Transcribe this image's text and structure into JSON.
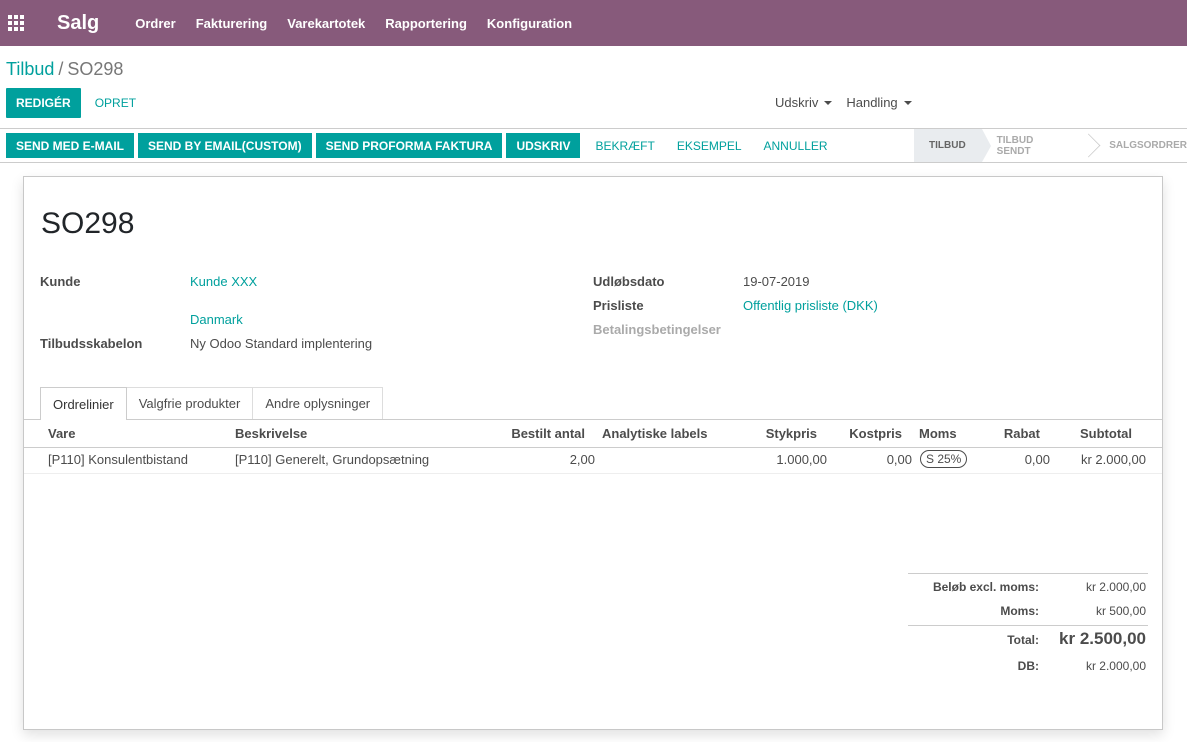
{
  "navbar": {
    "brand": "Salg",
    "menu": [
      "Ordrer",
      "Fakturering",
      "Varekartotek",
      "Rapportering",
      "Konfiguration"
    ],
    "background": "#875a7b"
  },
  "breadcrumb": {
    "parent": "Tilbud",
    "separator": "/",
    "current": "SO298"
  },
  "control": {
    "edit_label": "REDIGÉR",
    "create_label": "OPRET",
    "print_label": "Udskriv",
    "action_label": "Handling"
  },
  "statusbar": {
    "buttons": [
      "SEND MED E-MAIL",
      "SEND BY EMAIL(CUSTOM)",
      "SEND PROFORMA FAKTURA",
      "UDSKRIV"
    ],
    "links": [
      "BEKRÆFT",
      "EKSEMPEL",
      "ANNULLER"
    ],
    "stages": [
      "TILBUD",
      "TILBUD SENDT",
      "SALGSORDRER"
    ],
    "active_stage": "TILBUD"
  },
  "form": {
    "title": "SO298",
    "customer_label": "Kunde",
    "customer_name": "Kunde XXX",
    "customer_country": "Danmark",
    "template_label": "Tilbudsskabelon",
    "template_value": "Ny Odoo Standard implentering",
    "expiry_label": "Udløbsdato",
    "expiry_value": "19-07-2019",
    "pricelist_label": "Prisliste",
    "pricelist_value": "Offentlig prisliste (DKK)",
    "payment_terms_label": "Betalingsbetingelser"
  },
  "tabs": [
    "Ordrelinier",
    "Valgfrie produkter",
    "Andre oplysninger"
  ],
  "table": {
    "headers": [
      "Vare",
      "Beskrivelse",
      "Bestilt antal",
      "Analytiske labels",
      "Stykpris",
      "Kostpris",
      "Moms",
      "Rabat",
      "Subtotal"
    ],
    "rows": [
      {
        "product": "[P110] Konsulentbistand",
        "description": "[P110] Generelt, Grundopsætning",
        "qty": "2,00",
        "analytic": "",
        "unit_price": "1.000,00",
        "cost": "0,00",
        "tax": "S 25%",
        "discount": "0,00",
        "subtotal": "kr 2.000,00"
      }
    ]
  },
  "totals": {
    "untaxed_label": "Beløb excl. moms:",
    "untaxed_value": "kr 2.000,00",
    "tax_label": "Moms:",
    "tax_value": "kr 500,00",
    "total_label": "Total:",
    "total_value": "kr 2.500,00",
    "margin_label": "DB:",
    "margin_value": "kr 2.000,00"
  },
  "colors": {
    "accent": "#00a09d",
    "brand": "#875a7b"
  }
}
